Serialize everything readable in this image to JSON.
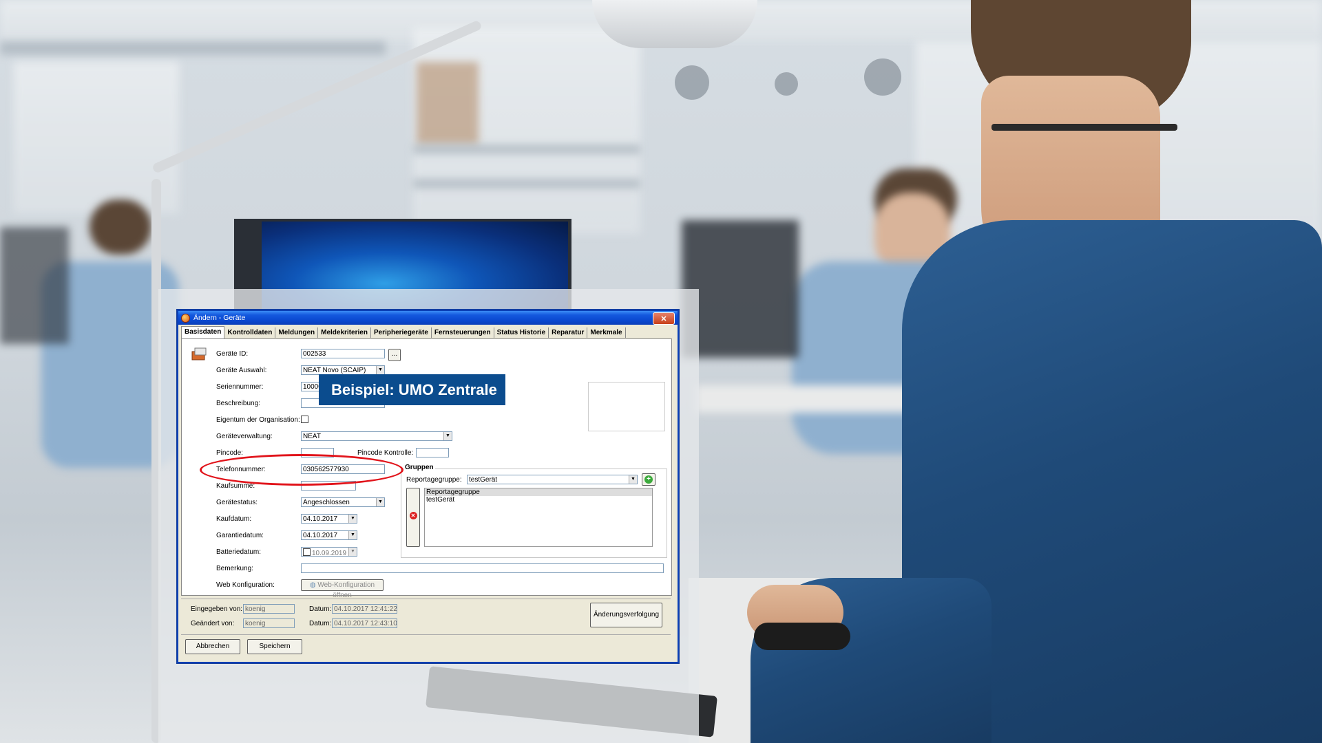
{
  "dialog": {
    "title": "Ändern - Geräte",
    "close_glyph": "✕",
    "tabs": [
      "Basisdaten",
      "Kontrolldaten",
      "Meldungen",
      "Meldekriterien",
      "Peripheriegeräte",
      "Fernsteuerungen",
      "Status Historie",
      "Reparatur",
      "Merkmale"
    ],
    "active_tab": "Basisdaten",
    "fields": {
      "geraete_id": {
        "label": "Geräte ID:",
        "value": "002533"
      },
      "geraete_auswahl": {
        "label": "Geräte Auswahl:",
        "value": "NEAT Novo (SCAIP)"
      },
      "seriennummer": {
        "label": "Seriennummer:",
        "value": "1000070"
      },
      "beschreibung": {
        "label": "Beschreibung:",
        "value": ""
      },
      "eigentum": {
        "label": "Eigentum der Organisation:"
      },
      "geraeteverwaltung": {
        "label": "Geräteverwaltung:",
        "value": "NEAT"
      },
      "pincode": {
        "label": "Pincode:",
        "value": ""
      },
      "pincode_kontrolle": {
        "label": "Pincode Kontrolle:",
        "value": ""
      },
      "telefonnummer": {
        "label": "Telefonnummer:",
        "value": "030562577930"
      },
      "kaufsumme": {
        "label": "Kaufsumme:",
        "value": ""
      },
      "geraetestatus": {
        "label": "Gerätestatus:",
        "value": "Angeschlossen"
      },
      "kaufdatum": {
        "label": "Kaufdatum:",
        "value": "04.10.2017"
      },
      "garantiedatum": {
        "label": "Garantiedatum:",
        "value": "04.10.2017"
      },
      "batteriedatum": {
        "label": "Batteriedatum:",
        "value": "10.09.2019"
      },
      "bemerkung": {
        "label": "Bemerkung:",
        "value": ""
      },
      "web_konfiguration": {
        "label": "Web Konfiguration:",
        "button": "Web-Konfiguration öffnen"
      }
    },
    "gruppen": {
      "title": "Gruppen",
      "reportagegruppe_label": "Reportagegruppe:",
      "reportagegruppe_value": "testGerät",
      "list_header": "Reportagegruppe",
      "list_items": [
        "testGerät"
      ]
    },
    "footer": {
      "eingegeben_von_label": "Eingegeben von:",
      "eingegeben_von_value": "koenig",
      "geaendert_von_label": "Geändert von:",
      "geaendert_von_value": "koenig",
      "datum_label": "Datum:",
      "datum1": "04.10.2017 12:41:22",
      "datum2": "04.10.2017 12:43:10",
      "aenderungsverfolgung": "Änderungsverfolgung"
    },
    "buttons": {
      "abbrechen": "Abbrechen",
      "speichern": "Speichern",
      "browse": "..."
    }
  },
  "callout": {
    "text": "Beispiel: UMO Zentrale"
  },
  "colors": {
    "callout_bg": "#0b4c8e",
    "highlight_ring": "#e1141b",
    "titlebar": "#0a48d0"
  }
}
